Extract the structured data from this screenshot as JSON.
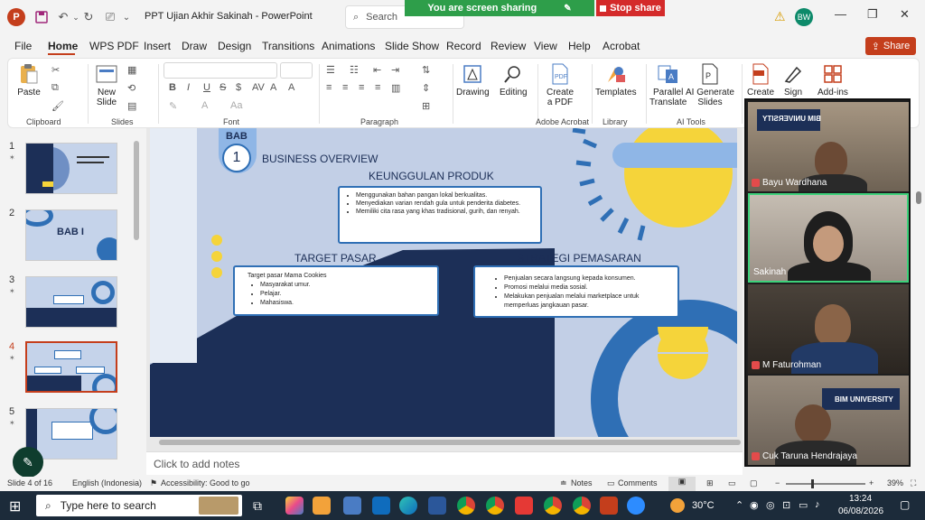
{
  "window": {
    "title": "PPT Ujian Akhir Sakinah  -  PowerPoint",
    "search_placeholder": "Search",
    "share_banner": "You are screen sharing",
    "stop_share": "Stop share",
    "avatar_initials": "BW"
  },
  "ribbon_tabs": [
    "File",
    "Home",
    "WPS PDF",
    "Insert",
    "Draw",
    "Design",
    "Transitions",
    "Animations",
    "Slide Show",
    "Record",
    "Review",
    "View",
    "Help",
    "Acrobat"
  ],
  "share_button": "Share",
  "ribbon": {
    "paste": "Paste",
    "clipboard": "Clipboard",
    "new_slide_1": "New",
    "new_slide_2": "Slide",
    "slides": "Slides",
    "font": "Font",
    "paragraph": "Paragraph",
    "drawing": "Drawing",
    "editing": "Editing",
    "create_pdf_1": "Create",
    "create_pdf_2": "a PDF",
    "adobe_acrobat": "Adobe Acrobat",
    "templates": "Templates",
    "library": "Library",
    "parallel_1": "Parallel",
    "parallel_2": "Translate",
    "ai_gen_1": "AI Generate",
    "ai_gen_2": "Slides",
    "ai_tools": "AI Tools",
    "create": "Create",
    "sign": "Sign",
    "addins": "Add-ins"
  },
  "thumbnails": [
    {
      "num": "1"
    },
    {
      "num": "2",
      "text": "BAB I"
    },
    {
      "num": "3"
    },
    {
      "num": "4"
    },
    {
      "num": "5"
    }
  ],
  "slide": {
    "bab_label": "BAB",
    "bab_number": "1",
    "section_title": "BUSINESS OVERVIEW",
    "keunggulan_title": "KEUNGGULAN PRODUK",
    "keunggulan_items": [
      "Menggunakan bahan pangan lokal berkualitas.",
      "Menyediakan varian rendah gula untuk penderita diabetes.",
      "Memiliki cita rasa yang khas tradisional, gurih, dan renyah."
    ],
    "target_title": "TARGET PASAR",
    "target_intro": "Target pasar Mama Cookies",
    "target_items": [
      "Masyarakat umur.",
      "Pelajar.",
      "Mahasiswa."
    ],
    "strategi_title": "STRATEGI PEMASARAN",
    "strategi_items": [
      "Penjualan secara langsung kepada konsumen.",
      "Promosi melalui media sosial.",
      "Melakukan penjualan melalui marketplace untuk memperluas jangkauan pasar."
    ]
  },
  "notes_placeholder": "Click to add notes",
  "participants": [
    {
      "name": "Bayu Wardhana",
      "bg": "#8a7a68"
    },
    {
      "name": "Sakinah",
      "bg": "#b8b0a6"
    },
    {
      "name": "M Faturohman",
      "bg": "#3a3530"
    },
    {
      "name": "Cuk Taruna Hendrajaya",
      "bg": "#7d7266"
    }
  ],
  "university_logo": "BIM UNIVERSITY",
  "status": {
    "slide_of": "Slide 4 of 16",
    "language": "English (Indonesia)",
    "accessibility": "Accessibility: Good to go",
    "notes": "Notes",
    "comments": "Comments",
    "zoom": "39%"
  },
  "taskbar": {
    "search_placeholder": "Type here to search",
    "temperature": "30°C",
    "time": "13:24",
    "date": "06/08/2026"
  },
  "colors": {
    "accent": "#c43e1c",
    "slide_bg": "#c2cfe6",
    "navy": "#1c2f57",
    "blue": "#2f6fb5",
    "yellow": "#f5d43a"
  }
}
